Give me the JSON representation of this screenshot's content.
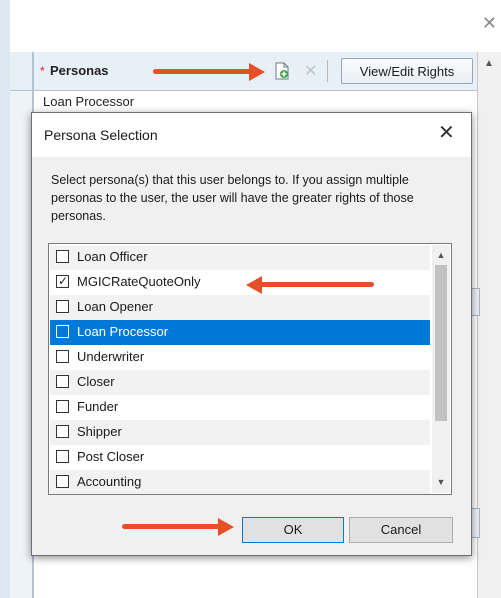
{
  "outer_window": {
    "close_glyph": "✕",
    "panel": {
      "required_marker": "*",
      "title": "Personas",
      "add_icon": "add-persona-icon",
      "delete_glyph": "✕",
      "view_rights_label": "View/Edit Rights",
      "visible_row": "Loan Processor"
    }
  },
  "dialog": {
    "title": "Persona Selection",
    "close_glyph": "✕",
    "instructions": "Select persona(s) that this user belongs to. If you assign multiple personas to the user, the user will have the greater rights of those personas.",
    "personas": [
      {
        "label": "Loan Officer",
        "checked": false,
        "selected": false
      },
      {
        "label": "MGICRateQuoteOnly",
        "checked": true,
        "selected": false
      },
      {
        "label": "Loan Opener",
        "checked": false,
        "selected": false
      },
      {
        "label": "Loan Processor",
        "checked": false,
        "selected": true
      },
      {
        "label": "Underwriter",
        "checked": false,
        "selected": false
      },
      {
        "label": "Closer",
        "checked": false,
        "selected": false
      },
      {
        "label": "Funder",
        "checked": false,
        "selected": false
      },
      {
        "label": "Shipper",
        "checked": false,
        "selected": false
      },
      {
        "label": "Post Closer",
        "checked": false,
        "selected": false
      },
      {
        "label": "Accounting",
        "checked": false,
        "selected": false
      }
    ],
    "ok_label": "OK",
    "cancel_label": "Cancel"
  },
  "colors": {
    "annotation_arrow": "#e5502b",
    "selection": "#0078d7"
  }
}
